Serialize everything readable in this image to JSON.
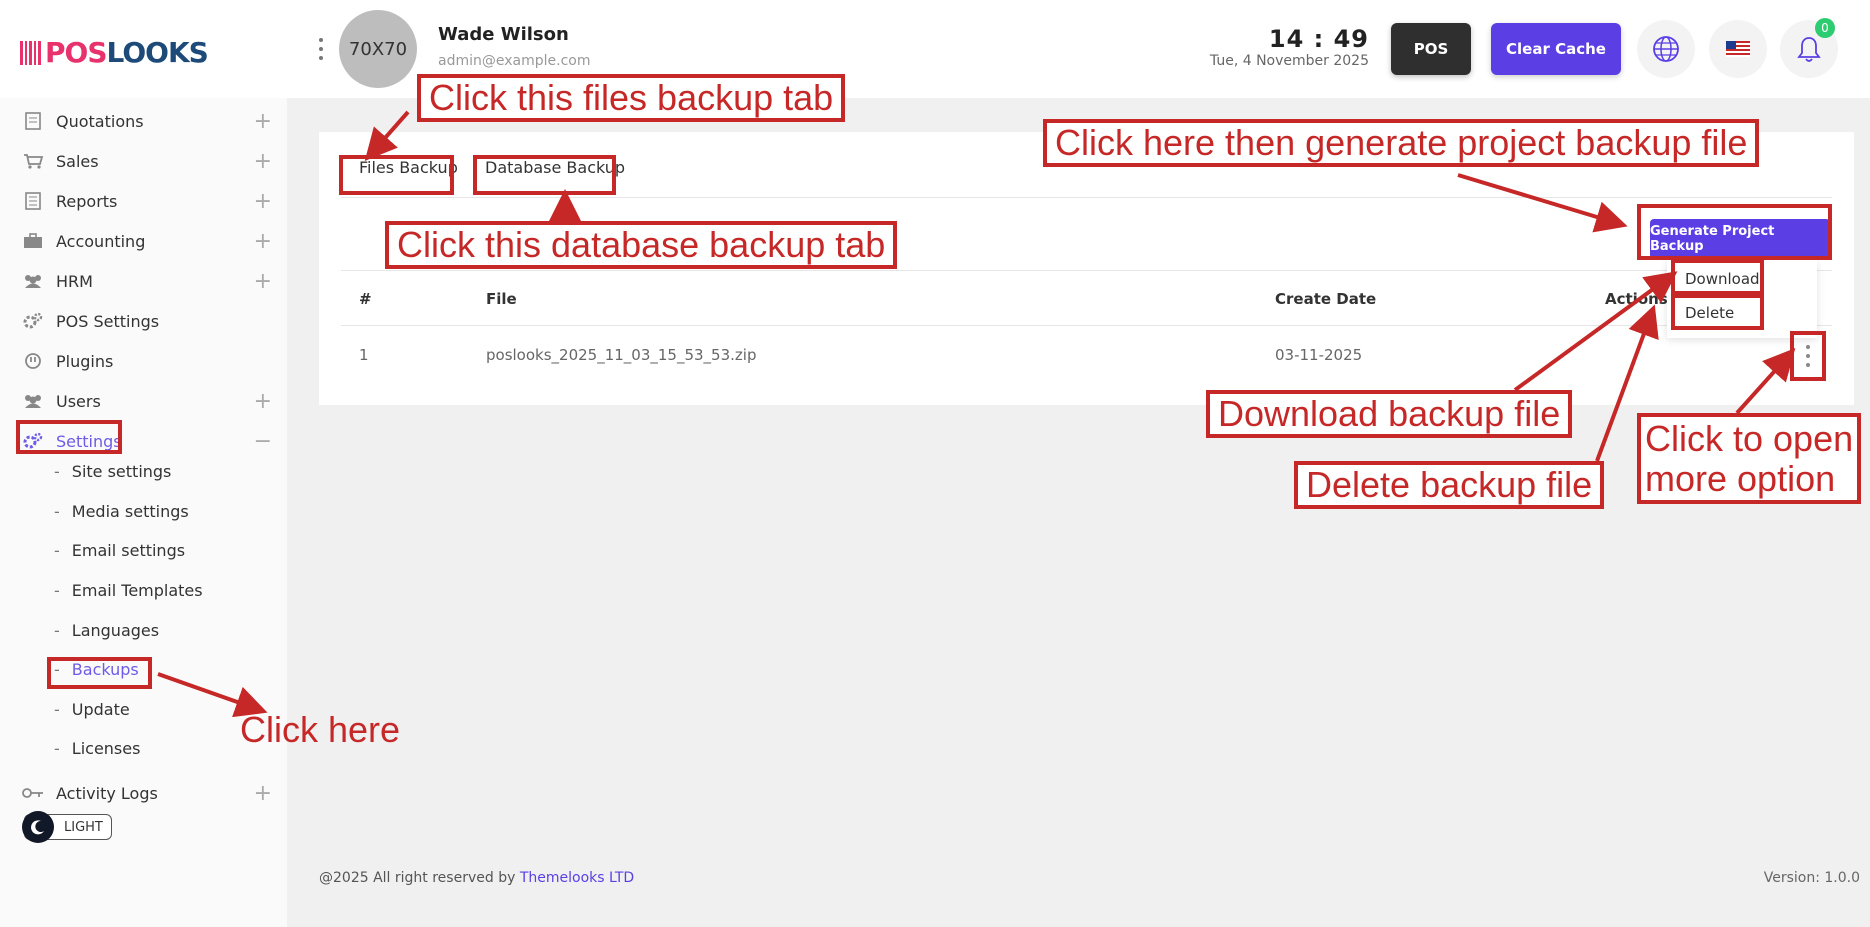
{
  "brand": {
    "logo_pos": "POS",
    "logo_looks": "LOOKS",
    "brand_pink": "#e8326c",
    "brand_navy": "#1d4a78"
  },
  "header": {
    "avatar_text": "70X70",
    "user_name": "Wade Wilson",
    "user_email": "admin@example.com",
    "time": "14 : 49",
    "date": "Tue, 4 November 2025",
    "pos_label": "POS",
    "clear_cache_label": "Clear Cache",
    "notification_count": "0",
    "accent": "#5b3fe4"
  },
  "sidebar": {
    "items": [
      {
        "label": "Quotations",
        "icon": "document-icon",
        "expand": "+"
      },
      {
        "label": "Sales",
        "icon": "cart-icon",
        "expand": "+"
      },
      {
        "label": "Reports",
        "icon": "report-icon",
        "expand": "+"
      },
      {
        "label": "Accounting",
        "icon": "briefcase-icon",
        "expand": "+"
      },
      {
        "label": "HRM",
        "icon": "people-icon",
        "expand": "+"
      },
      {
        "label": "POS Settings",
        "icon": "gears-icon"
      },
      {
        "label": "Plugins",
        "icon": "plug-icon"
      },
      {
        "label": "Users",
        "icon": "users-icon",
        "expand": "+"
      },
      {
        "label": "Settings",
        "icon": "settings-icon",
        "expand": "−"
      }
    ],
    "sub_items": [
      "Site settings",
      "Media settings",
      "Email settings",
      "Email Templates",
      "Languages",
      "Backups",
      "Update",
      "Licenses"
    ],
    "sub_dash": "-",
    "activity": {
      "label": "Activity Logs",
      "icon": "key-icon",
      "expand": "+"
    },
    "theme_label": "LIGHT"
  },
  "backup": {
    "tabs": [
      "Files Backup",
      "Database Backup"
    ],
    "generate_label": "Generate Project Backup",
    "columns": [
      "#",
      "File",
      "Create Date",
      "Actions"
    ],
    "rows": [
      {
        "index": "1",
        "file": "poslooks_2025_11_03_15_53_53.zip",
        "date": "03-11-2025"
      }
    ],
    "menu": [
      "Download",
      "Delete"
    ]
  },
  "footer": {
    "copyright": "@2025 All right reserved by",
    "company": "Themelooks LTD",
    "version": "Version: 1.0.0"
  },
  "annotations": {
    "files_tab": "Click this files backup tab",
    "generate": "Click here then generate project backup file",
    "db_tab": "Click this database backup tab",
    "download": "Download backup file",
    "delete": "Delete backup file",
    "more_1": "Click to open",
    "more_2": "more option",
    "click_here": "Click here",
    "color": "#c62828"
  }
}
